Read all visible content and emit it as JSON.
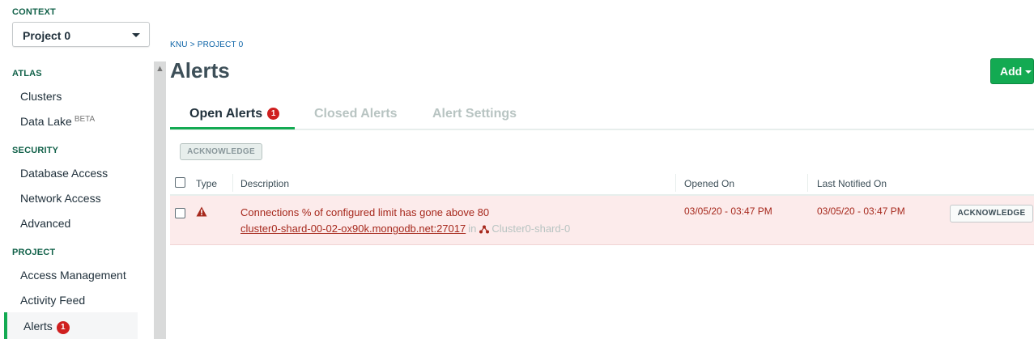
{
  "sidebar": {
    "context_heading": "CONTEXT",
    "context_value": "Project 0",
    "atlas_heading": "ATLAS",
    "clusters": "Clusters",
    "data_lake": "Data Lake",
    "data_lake_badge": "BETA",
    "security_heading": "SECURITY",
    "database_access": "Database Access",
    "network_access": "Network Access",
    "advanced": "Advanced",
    "project_heading": "PROJECT",
    "access_management": "Access Management",
    "activity_feed": "Activity Feed",
    "alerts": "Alerts",
    "alerts_count": "1"
  },
  "breadcrumb": "KNU > PROJECT 0",
  "page_title": "Alerts",
  "add_button": "Add",
  "tabs": [
    {
      "label": "Open Alerts",
      "count": "1",
      "active": true
    },
    {
      "label": "Closed Alerts",
      "active": false
    },
    {
      "label": "Alert Settings",
      "active": false
    }
  ],
  "bulk_acknowledge": "ACKNOWLEDGE",
  "table": {
    "headers": [
      "Type",
      "Description",
      "Opened On",
      "Last Notified On"
    ],
    "rows": [
      {
        "type": "warning",
        "description": "Connections % of configured limit has gone above 80",
        "host": "cluster0-shard-00-02-ox90k.mongodb.net:27017",
        "in_word": "in",
        "cluster": "Cluster0-shard-0",
        "opened_on": "03/05/20 - 03:47 PM",
        "last_notified": "03/05/20 - 03:47 PM",
        "action": "ACKNOWLEDGE"
      }
    ]
  },
  "colors": {
    "accent_green": "#13aa52",
    "alert_red": "#a6281c",
    "alert_row_bg": "#fcebeb",
    "badge_red": "#cf1f1f"
  }
}
